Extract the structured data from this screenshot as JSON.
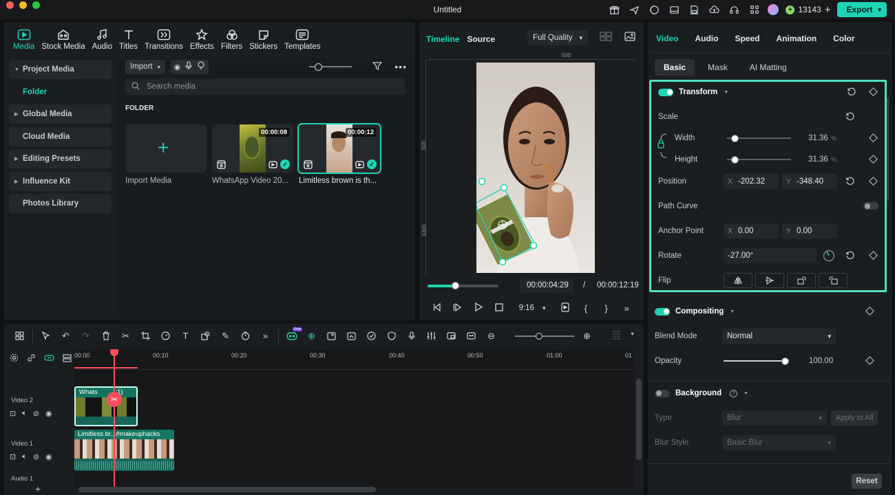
{
  "app": {
    "title": "Untitled",
    "credits": "13143",
    "export_label": "Export",
    "colors": {
      "accent": "#1fd4b4",
      "highlight_box": "#4fe1c2",
      "playhead": "#ff4d5b",
      "close": "#ff5f57",
      "minimize": "#febc2e",
      "maximize": "#28c840"
    }
  },
  "media_tabs": [
    {
      "label": "Media",
      "icon": "media-icon",
      "active": true
    },
    {
      "label": "Stock Media",
      "icon": "stock-media-icon"
    },
    {
      "label": "Audio",
      "icon": "music-note-icon"
    },
    {
      "label": "Titles",
      "icon": "text-t-icon"
    },
    {
      "label": "Transitions",
      "icon": "transitions-icon"
    },
    {
      "label": "Effects",
      "icon": "effects-star-icon"
    },
    {
      "label": "Filters",
      "icon": "filters-icon"
    },
    {
      "label": "Stickers",
      "icon": "stickers-icon"
    },
    {
      "label": "Templates",
      "icon": "templates-icon"
    }
  ],
  "media_sidebar": {
    "project_media": "Project Media",
    "folder": "Folder",
    "global_media": "Global Media",
    "cloud_media": "Cloud Media",
    "editing_presets": "Editing Presets",
    "influence_kit": "Influence Kit",
    "photos_library": "Photos Library"
  },
  "media_main": {
    "import_label": "Import",
    "search_placeholder": "Search media",
    "folder_heading": "FOLDER",
    "tiles": [
      {
        "caption": "Import Media"
      },
      {
        "caption": "WhatsApp Video 20...",
        "duration": "00:00:08"
      },
      {
        "caption": "Limitless brown is th...",
        "duration": "00:00:12"
      }
    ]
  },
  "preview": {
    "tab_timeline": "Timeline",
    "tab_source": "Source",
    "quality": "Full Quality",
    "ruler_500": "500",
    "ruler_1000": "1000",
    "current_time": "00:00:04:29",
    "separator": "/",
    "total_time": "00:00:12:19",
    "aspect": "9:16",
    "scrub_progress": 0.39
  },
  "inspector": {
    "tabs": [
      "Video",
      "Audio",
      "Speed",
      "Animation",
      "Color"
    ],
    "subtabs": [
      "Basic",
      "Mask",
      "AI Matting"
    ],
    "transform": {
      "title": "Transform",
      "scale_label": "Scale",
      "width_label": "Width",
      "width_value": "31.36",
      "height_label": "Height",
      "height_value": "31.36",
      "unit": "%",
      "position_label": "Position",
      "pos_x_axis": "X",
      "pos_x": "-202.32",
      "pos_y_axis": "Y",
      "pos_y": "-348.40",
      "path_curve_label": "Path Curve",
      "anchor_label": "Anchor Point",
      "anchor_x": "0.00",
      "anchor_y": "0.00",
      "rotate_label": "Rotate",
      "rotate_value": "-27.00°",
      "flip_label": "Flip"
    },
    "compositing": {
      "title": "Compositing",
      "blend_label": "Blend Mode",
      "blend_value": "Normal",
      "opacity_label": "Opacity",
      "opacity_value": "100.00"
    },
    "background": {
      "title": "Background",
      "type_label": "Type",
      "type_value": "Blur",
      "apply_all": "Apply to All",
      "blur_style_label": "Blur Style",
      "blur_style_value": "Basic Blur"
    },
    "reset_label": "Reset"
  },
  "timeline": {
    "ruler_ticks": [
      "00:00",
      "00:10",
      "00:20",
      "00:30",
      "00:40",
      "00:50",
      "01:00",
      "01"
    ],
    "tracks": [
      {
        "label": "Video 2"
      },
      {
        "label": "Video 1"
      },
      {
        "label": "Audio 1"
      }
    ],
    "clip_video2_title": "Whats",
    "clip_video2_suffix": "1)",
    "clip_video1_title": "Limitless br...#makeuphacks",
    "ai_badge": "Free"
  }
}
